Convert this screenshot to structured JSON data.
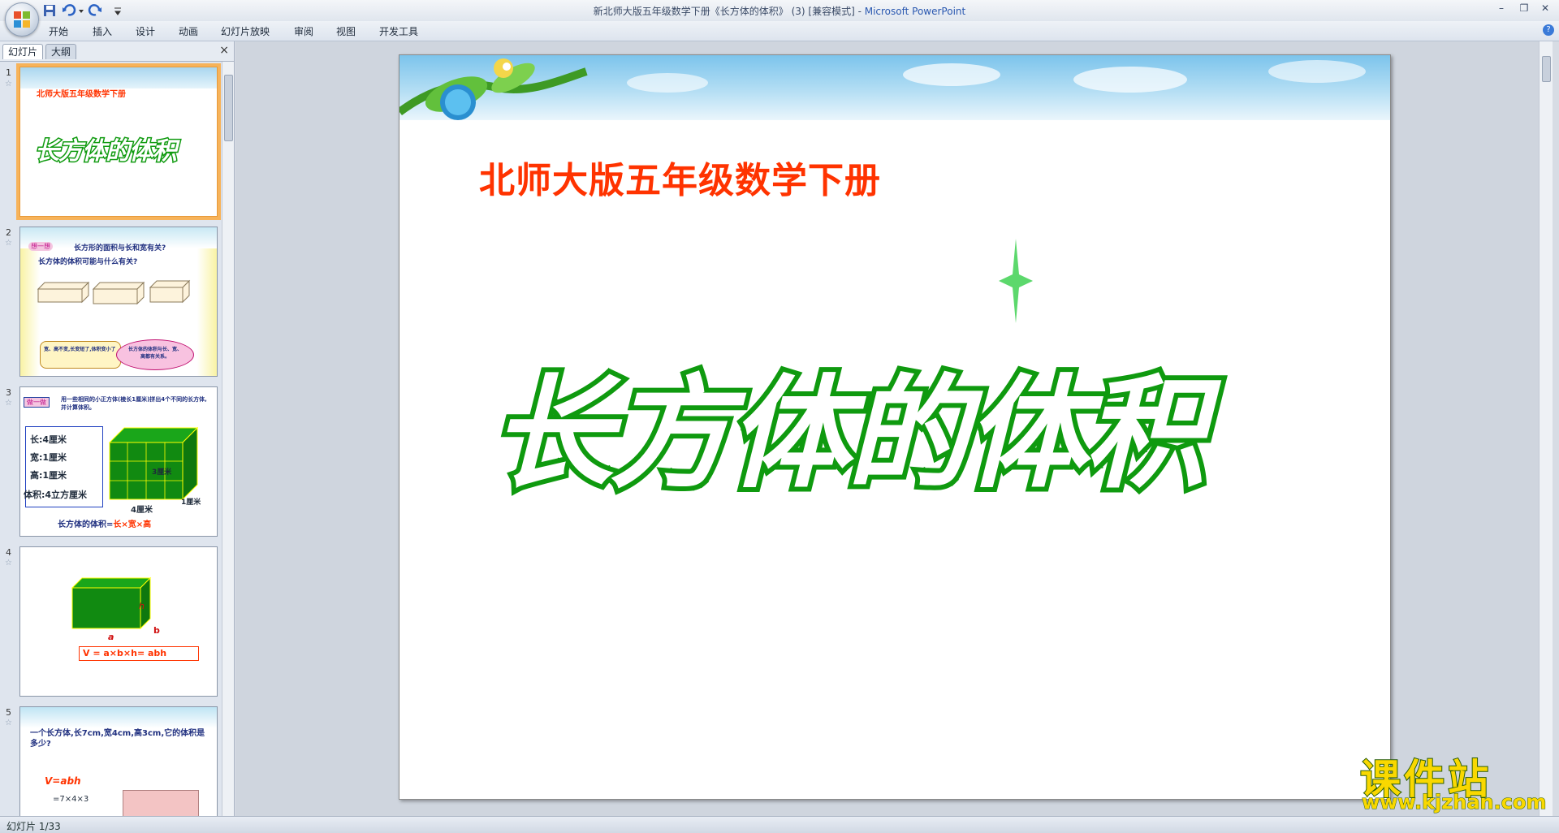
{
  "window": {
    "title": "新北师大版五年级数学下册《长方体的体积》 (3) [兼容模式] - ",
    "app_name": "Microsoft PowerPoint"
  },
  "ribbon": {
    "tabs": [
      "开始",
      "插入",
      "设计",
      "动画",
      "幻灯片放映",
      "审阅",
      "视图",
      "开发工具"
    ]
  },
  "panel": {
    "tab_slides": "幻灯片",
    "tab_outline": "大纲",
    "close": "×"
  },
  "thumbnails": [
    {
      "num": "1",
      "subtitle": "北师大版五年级数学下册",
      "title": "长方体的体积"
    },
    {
      "num": "2",
      "heading": "长方形的面积与长和宽有关?",
      "line2": "长方体的体积可能与什么有关?",
      "bubble_left": "宽、高不变,长变短了,体积变小了",
      "bubble_right": "长方体的体积与长、宽、高都有关系。",
      "tag": "想一想"
    },
    {
      "num": "3",
      "tag": "做一做",
      "text": "用一些相同的小正方体(棱长1厘米)拼出4个不同的长方体,并计算体积。",
      "rows": [
        "长:4厘米",
        "宽:1厘米",
        "高:1厘米",
        "体积:4立方厘米"
      ],
      "dim1": "3厘米",
      "dim2": "4厘米",
      "dim3": "1厘米",
      "formula_label": "长方体的体积=",
      "formula": "长×宽×高"
    },
    {
      "num": "4",
      "label_h": "h",
      "label_a": "a",
      "label_b": "b",
      "formula": "V = a×b×h= abh"
    },
    {
      "num": "5",
      "text": "一个长方体,长7cm,宽4cm,高3cm,它的体积是多少?",
      "formula": "V=abh",
      "calc": "=7×4×3"
    }
  ],
  "slide": {
    "subtitle": "北师大版五年级数学下册",
    "title": "长方体的体积"
  },
  "watermark": {
    "main": "课件站",
    "url": "www.kjzhan.com"
  },
  "status": {
    "text": "幻灯片 1/33"
  },
  "colors": {
    "title_green": "#0f9a0f",
    "subtitle_red": "#ff3300",
    "selection_orange": "#f7b35a"
  }
}
